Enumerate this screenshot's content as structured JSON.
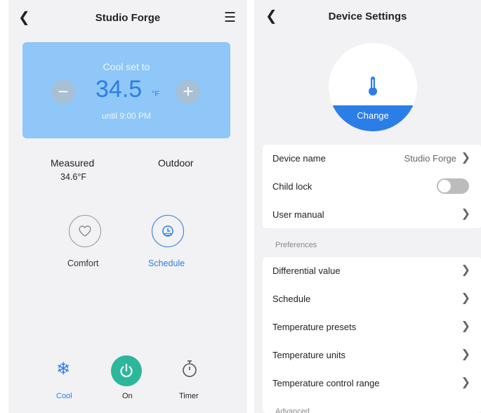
{
  "left_screen": {
    "title": "Studio Forge",
    "back_icon": "chevron-left-icon",
    "menu_icon": "hamburger-menu-icon",
    "setpoint": {
      "label": "Cool set to",
      "value": "34.5",
      "unit": "°F",
      "until": "until 9:00 PM",
      "minus_label": "−",
      "plus_label": "+"
    },
    "readings": {
      "measured_label": "Measured",
      "measured_value": "34.6°F",
      "outdoor_label": "Outdoor"
    },
    "modes": [
      {
        "label": "Comfort",
        "icon": "heart-icon",
        "active": false
      },
      {
        "label": "Schedule",
        "icon": "schedule-clock-icon",
        "active": true
      }
    ],
    "bottom_bar": {
      "cool_label": "Cool",
      "on_label": "On",
      "timer_label": "Timer",
      "cool_glyph": "❄"
    },
    "colors": {
      "accent_blue": "#2b7ee8",
      "card_blue": "#8fc7f8",
      "power_green": "#2cb79a"
    }
  },
  "right_screen": {
    "title": "Device Settings",
    "back_icon": "chevron-left-icon",
    "device_icon": "thermometer-icon",
    "change_label": "Change",
    "general": [
      {
        "label": "Device name",
        "value": "Studio Forge"
      },
      {
        "label": "Child lock",
        "toggle": false
      },
      {
        "label": "User manual"
      }
    ],
    "preferences_label": "Preferences",
    "preferences": [
      {
        "label": "Differential value"
      },
      {
        "label": "Schedule"
      },
      {
        "label": "Temperature presets"
      },
      {
        "label": "Temperature units"
      },
      {
        "label": "Temperature control range"
      }
    ],
    "advanced_label": "Advanced"
  }
}
